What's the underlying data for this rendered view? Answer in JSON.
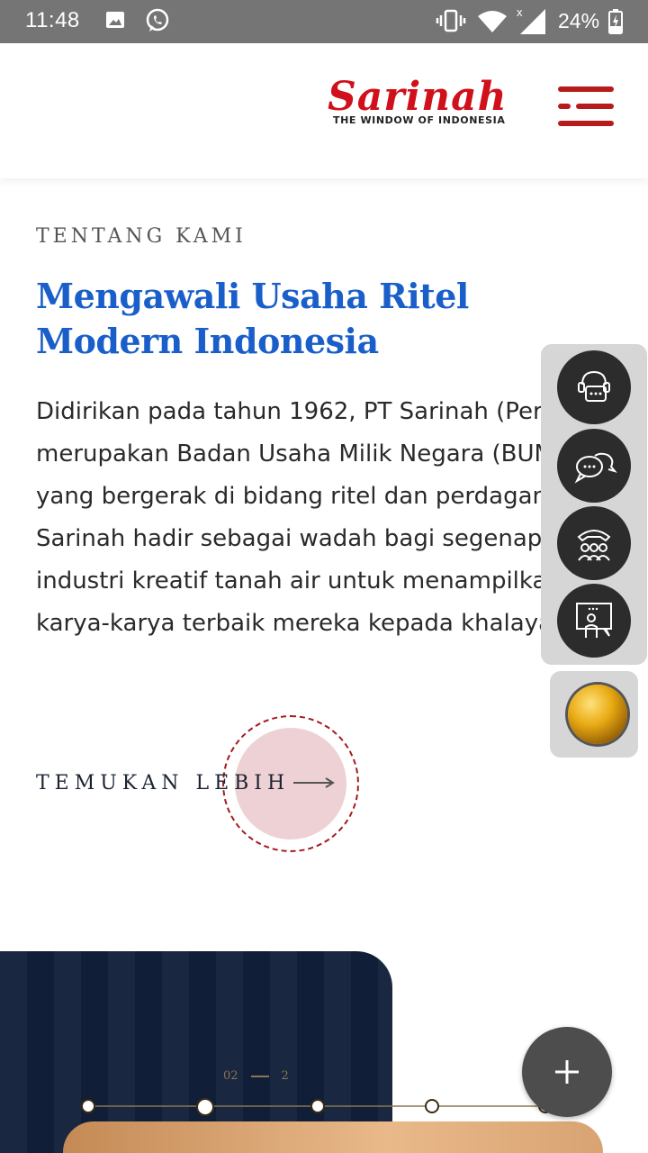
{
  "status_bar": {
    "time": "11:48",
    "battery": "24%",
    "icons": [
      "image-icon",
      "whatsapp-icon",
      "vibrate-icon",
      "wifi-icon",
      "signal-icon",
      "battery-icon"
    ]
  },
  "header": {
    "logo_text": "Sarinah",
    "logo_tagline": "THE WINDOW OF INDONESIA",
    "brand_color": "#d0101a",
    "menu_icon": "menu-icon"
  },
  "about": {
    "eyebrow": "TENTANG KAMI",
    "headline": "Mengawali Usaha Ritel Modern Indonesia",
    "body_lines": [
      "Didirikan pada tahun 1962, PT Sarinah (Persero)",
      "merupakan Badan Usaha Milik Negara (BUMN)",
      "yang bergerak di bidang ritel dan perdagangan.",
      "Sarinah hadir sebagai wadah bagi segenap pegiat",
      "industri kreatif tanah air untuk menampilkan",
      "karya-karya terbaik mereka kepada khalayak luas."
    ],
    "cta_label": "TEMUKAN LEBIH",
    "headline_color": "#1a5fc9"
  },
  "contact_widget": {
    "buttons": [
      "customer-service-icon",
      "chat-icon",
      "call-group-icon",
      "presentation-icon"
    ],
    "globe_icon": "globe-icon"
  },
  "slider": {
    "current": "02",
    "total": "2"
  },
  "fab": {
    "icon": "plus-icon",
    "label": "+"
  }
}
